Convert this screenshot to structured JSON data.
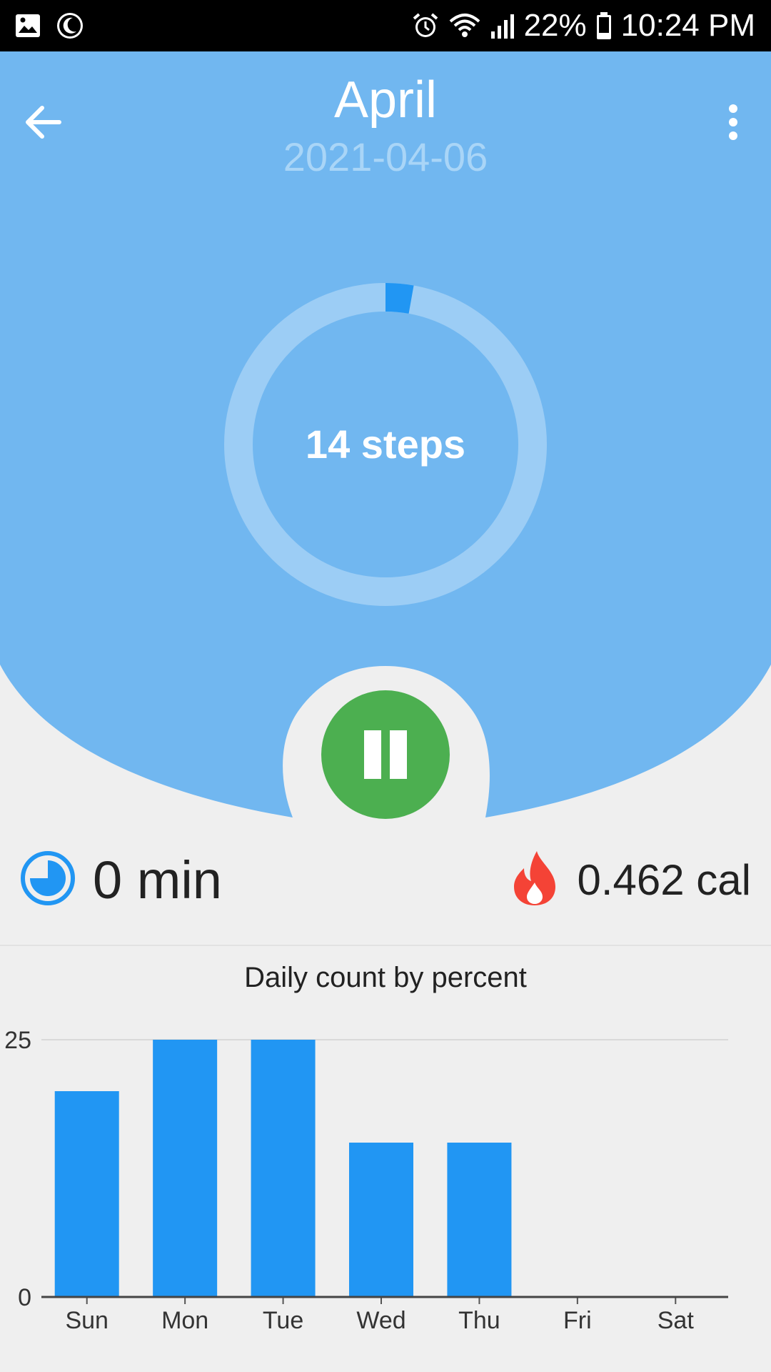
{
  "status_bar": {
    "icons_left": [
      "gallery-icon",
      "night-mode-icon"
    ],
    "icons_right": [
      "alarm-icon",
      "wifi-icon",
      "signal-icon",
      "battery-icon"
    ],
    "battery": "22%",
    "time": "10:24 PM"
  },
  "header": {
    "title": "April",
    "subtitle": "2021-04-06",
    "back_icon": "arrow-back-icon",
    "menu_icon": "more-vert-icon"
  },
  "progress": {
    "steps_text": "14 steps",
    "fraction": 0.028
  },
  "controls": {
    "pause_icon": "pause-icon"
  },
  "stats": {
    "time_value": "0 min",
    "time_icon": "clock-pie-icon",
    "calories_value": "0.462 cal",
    "calories_icon": "flame-icon"
  },
  "colors": {
    "header_blue": "#71b7f0",
    "accent_blue": "#2196f3",
    "ring_track": "#9ccdf5",
    "pause_green": "#4caf50",
    "flame_red": "#f44336"
  },
  "chart_data": {
    "type": "bar",
    "title": "Daily count by percent",
    "categories": [
      "Sun",
      "Mon",
      "Tue",
      "Wed",
      "Thu",
      "Fri",
      "Sat"
    ],
    "values": [
      20,
      25,
      25,
      15,
      15,
      0,
      0
    ],
    "y_ticks": [
      "0",
      "25"
    ],
    "ylim": [
      0,
      25
    ],
    "grid": true,
    "bar_color": "#2196f3"
  }
}
